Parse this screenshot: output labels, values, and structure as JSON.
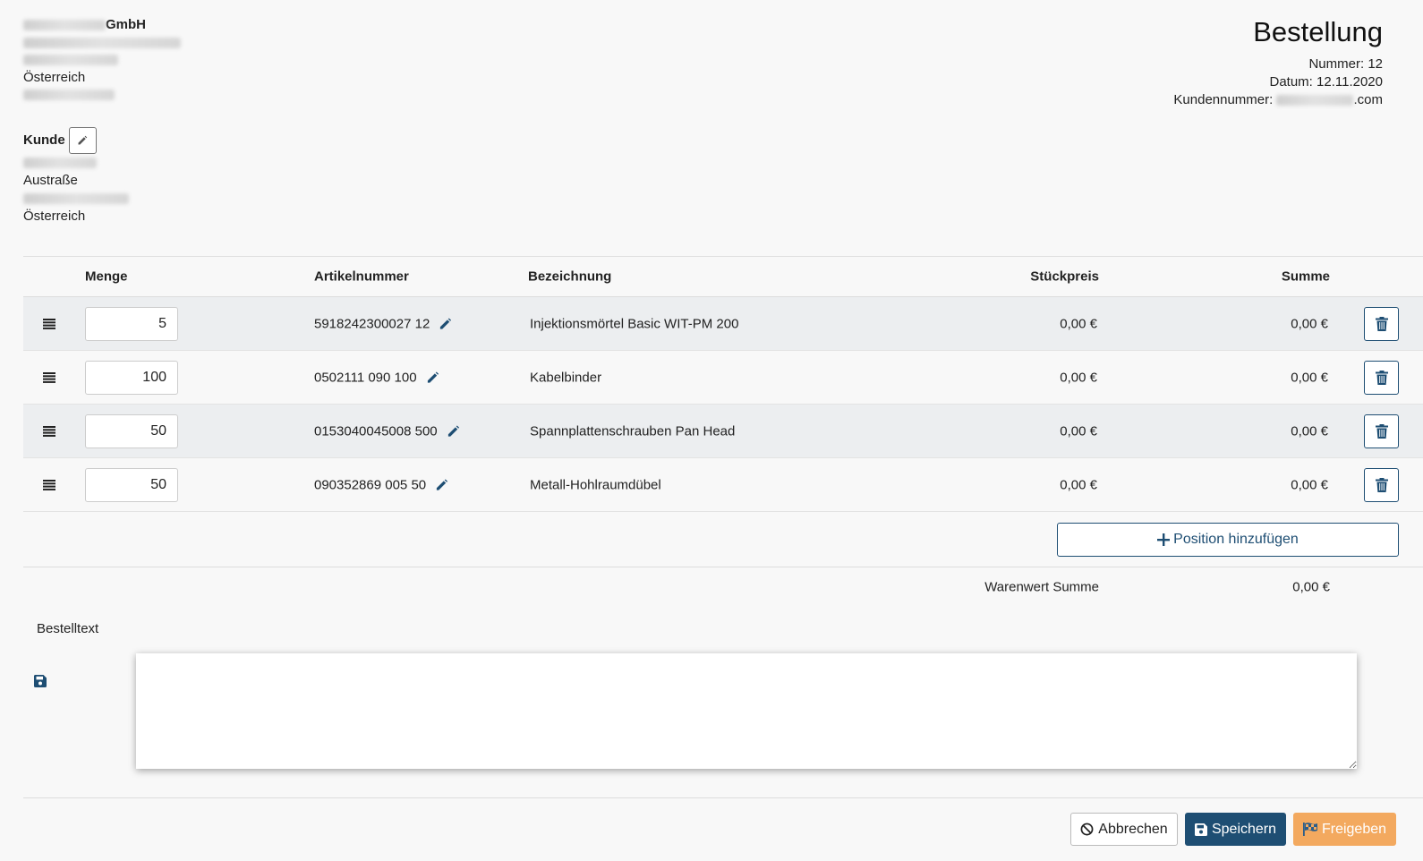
{
  "sender": {
    "company_suffix": "GmbH",
    "country": "Österreich"
  },
  "order": {
    "title": "Bestellung",
    "number_label": "Nummer:",
    "number": "12",
    "date_label": "Datum:",
    "date": "12.11.2020",
    "customer_number_label": "Kundennummer:",
    "customer_number_suffix": ".com"
  },
  "customer": {
    "heading": "Kunde",
    "street": "Austraße",
    "country": "Österreich"
  },
  "table": {
    "headers": {
      "qty": "Menge",
      "article": "Artikelnummer",
      "description": "Bezeichnung",
      "unit_price": "Stückpreis",
      "sum": "Summe"
    },
    "rows": [
      {
        "qty": "5",
        "article": "5918242300027 12",
        "description": "Injektionsmörtel Basic WIT-PM 200",
        "unit_price": "0,00 €",
        "sum": "0,00 €"
      },
      {
        "qty": "100",
        "article": "0502111 090 100",
        "description": "Kabelbinder",
        "unit_price": "0,00 €",
        "sum": "0,00 €"
      },
      {
        "qty": "50",
        "article": "0153040045008 500",
        "description": "Spannplattenschrauben Pan Head",
        "unit_price": "0,00 €",
        "sum": "0,00 €"
      },
      {
        "qty": "50",
        "article": "090352869 005 50",
        "description": "Metall-Hohlraumdübel",
        "unit_price": "0,00 €",
        "sum": "0,00 €"
      }
    ],
    "add_label": "Position hinzufügen",
    "total_label": "Warenwert Summe",
    "total_value": "0,00 €"
  },
  "order_text": {
    "label": "Bestelltext",
    "value": ""
  },
  "actions": {
    "cancel": "Abbrechen",
    "save": "Speichern",
    "release": "Freigeben"
  },
  "colors": {
    "primary": "#1e4e73",
    "release": "#f3a95f",
    "row_alt": "#eceef0"
  }
}
